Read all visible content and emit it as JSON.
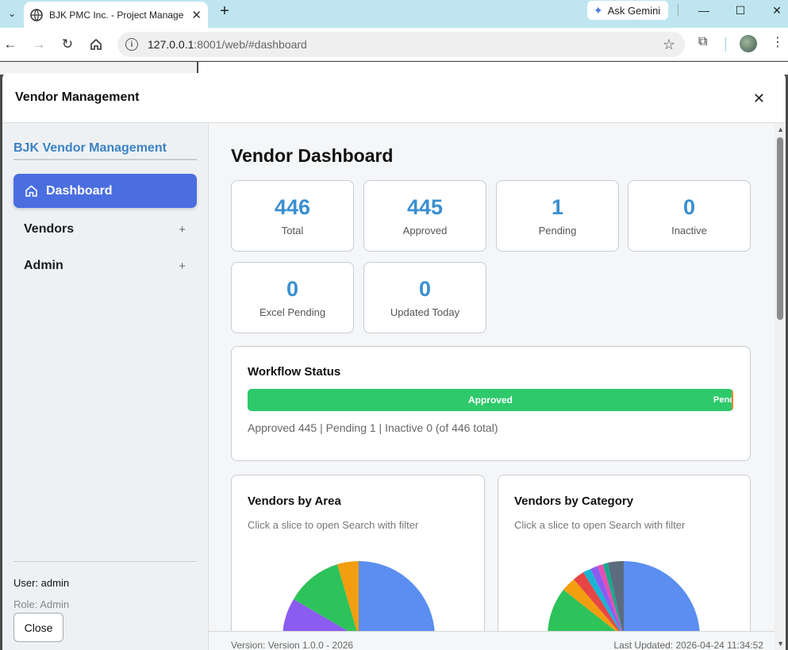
{
  "browser": {
    "tab_title": "BJK PMC Inc. - Project Managem",
    "gemini_label": "Ask Gemini",
    "url_host": "127.0.0.1",
    "url_rest": ":8001/web/#dashboard"
  },
  "modal": {
    "title": "Vendor Management",
    "close_icon": "close-icon"
  },
  "sidebar": {
    "brand": "BJK Vendor Management",
    "items": [
      {
        "label": "Dashboard",
        "icon": "home-icon",
        "active": true
      },
      {
        "label": "Vendors",
        "expand": "+"
      },
      {
        "label": "Admin",
        "expand": "+"
      }
    ],
    "user": "User: admin",
    "role": "Role: Admin",
    "close_label": "Close"
  },
  "dashboard": {
    "title": "Vendor Dashboard",
    "stats": [
      {
        "value": "446",
        "label": "Total"
      },
      {
        "value": "445",
        "label": "Approved"
      },
      {
        "value": "1",
        "label": "Pending"
      },
      {
        "value": "0",
        "label": "Inactive"
      },
      {
        "value": "0",
        "label": "Excel Pending"
      },
      {
        "value": "0",
        "label": "Updated Today"
      }
    ],
    "workflow": {
      "title": "Workflow Status",
      "approved_label": "Approved",
      "pending_label": "Pending",
      "summary": "Approved 445 | Pending 1 | Inactive 0 (of 446 total)",
      "approved_fraction": 0.9978
    },
    "area_card": {
      "title": "Vendors by Area",
      "subtitle": "Click a slice to open Search with filter"
    },
    "category_card": {
      "title": "Vendors by Category",
      "subtitle": "Click a slice to open Search with filter"
    },
    "footer": {
      "version": "Version: Version 1.0.0 - 2026",
      "updated": "Last Updated: 2026-04-24 11:34:52"
    }
  },
  "colors": {
    "accent": "#4a6ee0",
    "brand": "#3b82c4",
    "stat_number": "#3b8fd0",
    "approved": "#2ec96b",
    "pending": "#e08a1e"
  }
}
